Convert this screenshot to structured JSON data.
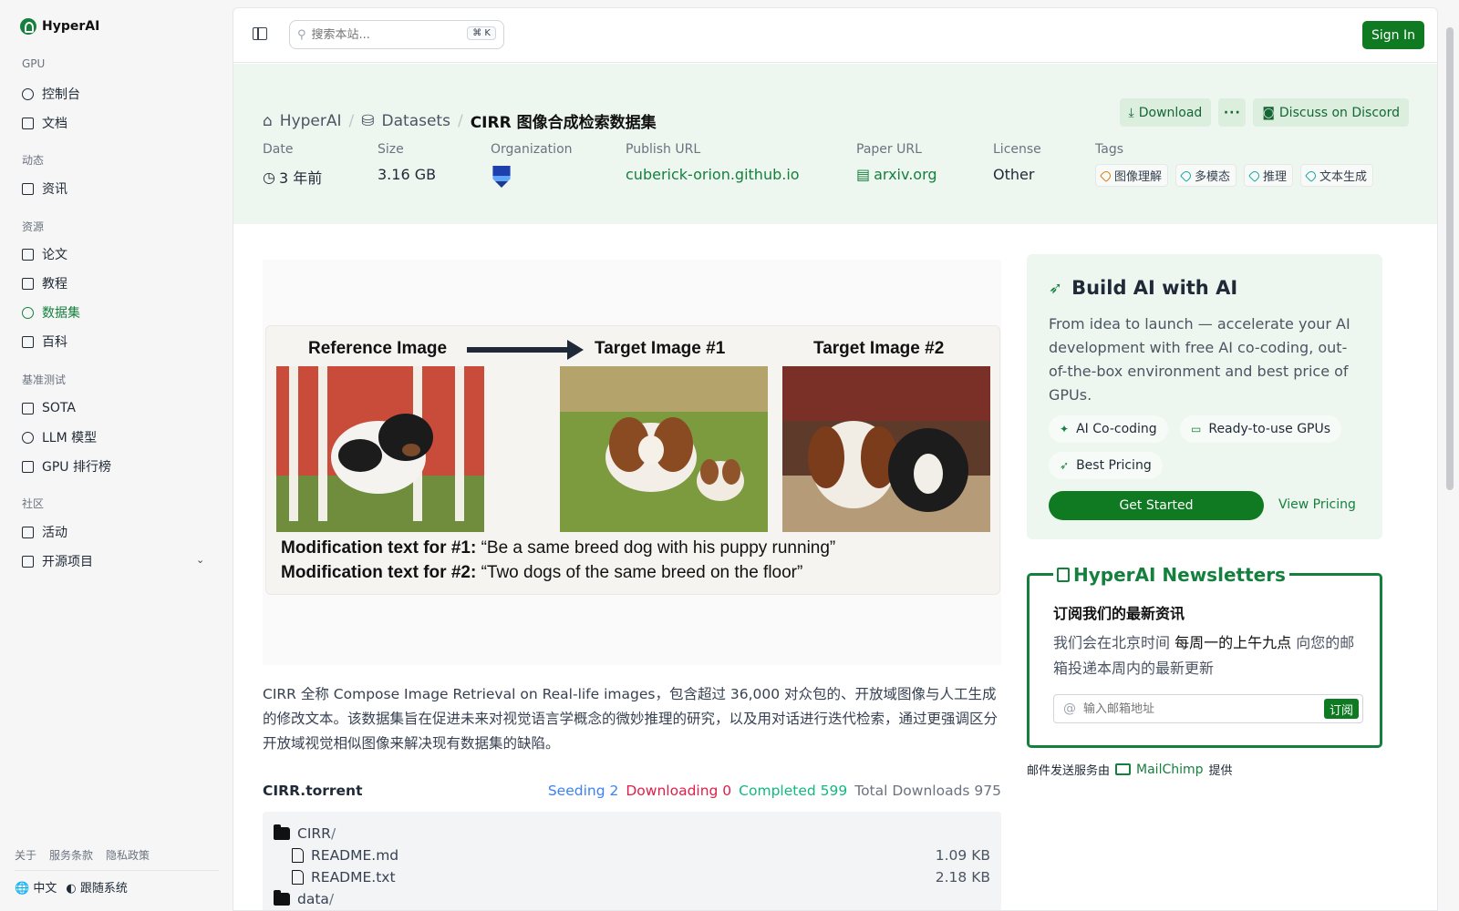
{
  "sidebar": {
    "brand": "HyperAI",
    "sections": [
      {
        "title": "GPU",
        "items": [
          {
            "label": "控制台"
          },
          {
            "label": "文档"
          }
        ]
      },
      {
        "title": "动态",
        "items": [
          {
            "label": "资讯"
          }
        ]
      },
      {
        "title": "资源",
        "items": [
          {
            "label": "论文"
          },
          {
            "label": "教程"
          },
          {
            "label": "数据集"
          },
          {
            "label": "百科"
          }
        ]
      },
      {
        "title": "基准测试",
        "items": [
          {
            "label": "SOTA"
          },
          {
            "label": "LLM 模型"
          },
          {
            "label": "GPU 排行榜"
          }
        ]
      },
      {
        "title": "社区",
        "items": [
          {
            "label": "活动"
          },
          {
            "label": "开源项目"
          }
        ]
      }
    ],
    "footer_links": [
      "关于",
      "服务条款",
      "隐私政策"
    ],
    "language": "中文",
    "theme": "跟随系统"
  },
  "topbar": {
    "search_placeholder": "搜索本站...",
    "shortcut": "⌘ K",
    "sign_in": "Sign In"
  },
  "header": {
    "breadcrumb": [
      "HyperAI",
      "Datasets",
      "CIRR 图像合成检索数据集"
    ],
    "download_label": "Download",
    "more_label": "···",
    "discord_label": "Discuss on Discord",
    "meta": {
      "date_label": "Date",
      "date_value": "3 年前",
      "size_label": "Size",
      "size_value": "3.16 GB",
      "org_label": "Organization",
      "publish_label": "Publish URL",
      "publish_value": "cuberick-orion.github.io",
      "paper_label": "Paper URL",
      "paper_value": "arxiv.org",
      "license_label": "License",
      "license_value": "Other",
      "tags_label": "Tags",
      "tags": [
        "图像理解",
        "多模态",
        "推理",
        "文本生成"
      ]
    }
  },
  "figure": {
    "reference_title": "Reference Image",
    "target1_title": "Target Image #1",
    "target2_title": "Target Image #2",
    "caption1_label": "Modification text for #1:",
    "caption1_text": "“Be a same breed dog with his puppy running”",
    "caption2_label": "Modification text for #2:",
    "caption2_text": "“Two dogs of the same breed on the floor”"
  },
  "description": "CIRR 全称 Compose Image Retrieval on Real-life images，包含超过 36,000 对众包的、开放域图像与人工生成的修改文本。该数据集旨在促进未来对视觉语言学概念的微妙推理的研究，以及用对话进行迭代检索，通过更强调区分开放域视觉相似图像来解决现有数据集的缺陷。",
  "torrent": {
    "name": "CIRR.torrent",
    "seeding": "Seeding 2",
    "downloading": "Downloading 0",
    "completed": "Completed 599",
    "total": "Total Downloads 975",
    "files": [
      {
        "name": "CIRR",
        "slash": "/",
        "type": "folder",
        "size": ""
      },
      {
        "name": "README.md",
        "type": "file",
        "size": "1.09 KB"
      },
      {
        "name": "README.txt",
        "type": "file",
        "size": "2.18 KB"
      },
      {
        "name": "data",
        "slash": "/",
        "type": "folder",
        "size": ""
      }
    ]
  },
  "promo": {
    "title": "Build AI with AI",
    "text": "From idea to launch — accelerate your AI development with free AI co-coding, out-of-the-box environment and best price of GPUs.",
    "features": [
      "AI Co-coding",
      "Ready-to-use GPUs",
      "Best Pricing"
    ],
    "get_started": "Get Started",
    "view_pricing": "View Pricing"
  },
  "newsletter": {
    "title": "HyperAI Newsletters",
    "heading": "订阅我们的最新资讯",
    "text_before": "我们会在北京时间 ",
    "text_bold": "每周一的上午九点",
    "text_after": " 向您的邮箱投递本周内的最新更新",
    "email_placeholder": "输入邮箱地址",
    "subscribe": "订阅",
    "provider_before": "邮件发送服务由",
    "provider_name": "MailChimp",
    "provider_after": "提供"
  },
  "colors": {
    "accent": "#15803d",
    "button": "#0f7a22",
    "header_bg": "#eef7ef"
  }
}
